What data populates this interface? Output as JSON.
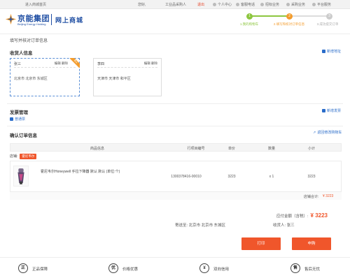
{
  "topbar": {
    "welcome": "进入商城首页",
    "login": "您好,",
    "account": "工业品采购人",
    "logout": "退出",
    "personal_center": "个人中心",
    "complaint": "客服电话",
    "procurement": "招标业务",
    "bidding": "采购业务",
    "platform": "平台服务"
  },
  "header": {
    "logo_cn": "京能集团",
    "logo_en": "Beijing Energy Holding",
    "mall_title": "网上商城",
    "steps": [
      {
        "num": "1",
        "label": "1.我的购物车",
        "state": "done"
      },
      {
        "num": "2",
        "label": "2.填写和校对订单信息",
        "state": "active"
      },
      {
        "num": "3",
        "label": "3.成功提交订单",
        "state": "todo"
      }
    ]
  },
  "hint": "填写并核对订单信息",
  "consignee": {
    "title": "收货人信息",
    "add_link": "新增地址",
    "default_badge": "默认",
    "cards": [
      {
        "name": "张三",
        "ops": "编辑  删除",
        "address": "北京市 北京市 东城区",
        "selected": true
      },
      {
        "name": "李四",
        "ops": "编辑  删除",
        "address": "天津市 天津市 和平区",
        "selected": false
      }
    ]
  },
  "invoice": {
    "title": "发票管理",
    "option": "普通票",
    "add_link": "新增发票"
  },
  "order": {
    "title": "确认订单信息",
    "back_link": "返回修改购物车",
    "columns": [
      "商品信息",
      "行项目编号",
      "单价",
      "数量",
      "小计"
    ],
    "shop_label": "店铺:",
    "shop_name": "霍尼韦尔",
    "item": {
      "name": "霍尼韦尔Honeywell 手拉下降器 默认 默认 (单位:个)",
      "line_no": "1300378416-00010",
      "price": "3223",
      "qty": "x 1",
      "subtotal": "3223"
    },
    "shop_subtotal_label": "店铺合计:",
    "shop_subtotal": "¥ 3223"
  },
  "summary": {
    "total_label": "应付金额（含税）:",
    "total_value": "¥ 3223",
    "ship_to_label": "寄送至:",
    "ship_to": "北京市 北京市 东城区",
    "receiver_label": "收货人:",
    "receiver": "张三"
  },
  "buttons": {
    "print": "打印",
    "submit": "申购"
  },
  "footer": [
    {
      "glyph": "正",
      "label": "正品保障"
    },
    {
      "glyph": "优",
      "label": "价格优惠"
    },
    {
      "glyph": "¥",
      "label": "双向信用"
    },
    {
      "glyph": "售",
      "label": "售后无忧"
    }
  ],
  "colors": {
    "brand": "#1f4ea3",
    "accent": "#f0562b",
    "step_done": "#8dc63f",
    "step_active": "#f39c2d",
    "link": "#2a6cc9"
  }
}
